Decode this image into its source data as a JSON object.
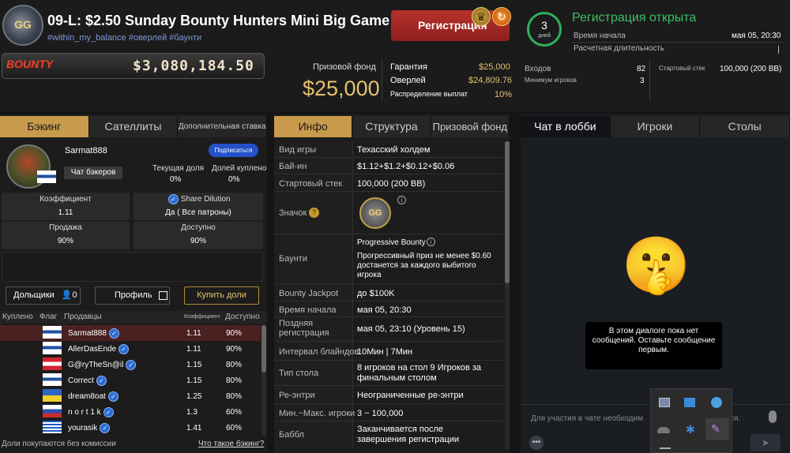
{
  "header": {
    "title": "09-L: $2.50 Sunday Bounty Hunters Mini Big Game",
    "tags": "#within_my_balance #оверлей #баунти",
    "logo_text": "GG",
    "bounty_logo": "BOUNTY",
    "bounty_amount": "$3,080,184.50",
    "prize_pool_label": "Призовой фонд",
    "prize_pool_value": "$25,000",
    "guarantee_label": "Гарантия",
    "guarantee_value": "$25,000",
    "overlay_label": "Оверлей",
    "overlay_value": "$24,809.76",
    "payout_label": "Распределение выплат",
    "payout_value": "10%",
    "register_button": "Регистрация",
    "days_number": "3",
    "days_label": "дней",
    "registration_status": "Регистрация открыта",
    "start_time_label": "Время начала",
    "start_time_value": "мая 05, 20:30",
    "est_duration_label": "Расчетная длительность",
    "entries_label": "Входов",
    "entries_value": "82",
    "min_players_label": "Минимум игроков",
    "min_players_value": "3",
    "starting_stack_label": "Стартовый стек",
    "starting_stack_value": "100,000 (200 BB)"
  },
  "left": {
    "tabs": [
      "Бэкинг",
      "Сателлиты",
      "Дополнительная ставка"
    ],
    "username": "Sarmat888",
    "subscribe_button": "Подписаться",
    "chat_backers": "Чат бэкеров",
    "current_share_label": "Текущая доля",
    "current_share_value": "0%",
    "shares_bought_label": "Долей куплено",
    "shares_bought_value": "0%",
    "coefficient_label": "Коэффициент",
    "coefficient_value": "1.11",
    "share_dilution_label": "Share Dilution",
    "share_dilution_value": "Да ( Все патроны)",
    "sale_label": "Продажа",
    "sale_value": "90%",
    "available_label": "Доступно",
    "available_value": "90%",
    "shareholders_button": "Дольщики",
    "shareholders_count": "0",
    "profile_button": "Профиль",
    "buy_shares_button": "Купить доли",
    "table_headers": [
      "Куплено",
      "Флаг",
      "Продавцы",
      "Коэффициент",
      "Доступно"
    ],
    "sellers": [
      {
        "name": "Sarmat888",
        "flag": "fi",
        "coef": "1.11",
        "avail": "90%"
      },
      {
        "name": "AllerDasEnde",
        "flag": "fi",
        "coef": "1.11",
        "avail": "90%"
      },
      {
        "name": "G@ryTheSn@il",
        "flag": "at",
        "coef": "1.15",
        "avail": "80%"
      },
      {
        "name": "Correct",
        "flag": "fi",
        "coef": "1.15",
        "avail": "80%"
      },
      {
        "name": "dream8oat",
        "flag": "ua",
        "coef": "1.25",
        "avail": "80%"
      },
      {
        "name": "n o r t 1 k",
        "flag": "ru",
        "coef": "1.3",
        "avail": "60%"
      },
      {
        "name": "yourasik",
        "flag": "gr",
        "coef": "1.41",
        "avail": "60%"
      }
    ],
    "footer_note": "Доли покупаются без комиссии",
    "footer_link": "Что такое бэкинг?"
  },
  "mid": {
    "tabs": [
      "Инфо",
      "Структура",
      "Призовой фонд"
    ],
    "rows": [
      {
        "k": "Вид игры",
        "v": "Техасский холдем"
      },
      {
        "k": "Бай-ин",
        "v": "$1.12+$1.2+$0.12+$0.06"
      },
      {
        "k": "Стартовый стек",
        "v": "100,000 (200 BB)"
      },
      {
        "k": "Значок",
        "v": ""
      },
      {
        "k": "Баунти",
        "v": "Прогрессивный приз не менее $0.60 достанется за каждого выбитого игрока",
        "v_title": "Progressive Bounty"
      },
      {
        "k": "Bounty Jackpot",
        "v": "до $100K"
      },
      {
        "k": "Время начала",
        "v": "мая 05, 20:30"
      },
      {
        "k": "Поздняя регистрация",
        "v": "мая 05, 23:10 (Уровень 15)"
      },
      {
        "k": "Интервал блайндов",
        "v": "10Мин | 7Мин"
      },
      {
        "k": "Тип стола",
        "v": "8 игроков на стол 9 Игроков за финальным столом"
      },
      {
        "k": "Ре-энтри",
        "v": "Неограниченные ре-энтри"
      },
      {
        "k": "Мин.~Макс. игроки",
        "v": "3 ~ 100,000"
      },
      {
        "k": "Баббл",
        "v": "Заканчивается после завершения регистрации"
      }
    ]
  },
  "right": {
    "tabs": [
      "Чат в лобби",
      "Игроки",
      "Столы"
    ],
    "empty_message": "В этом диалоге пока нет сообщений. Оставьте сообщение первым.",
    "input_placeholder": "Для участия в чате необходим",
    "input_suffix": "ся.",
    "emoji": "🤫"
  }
}
